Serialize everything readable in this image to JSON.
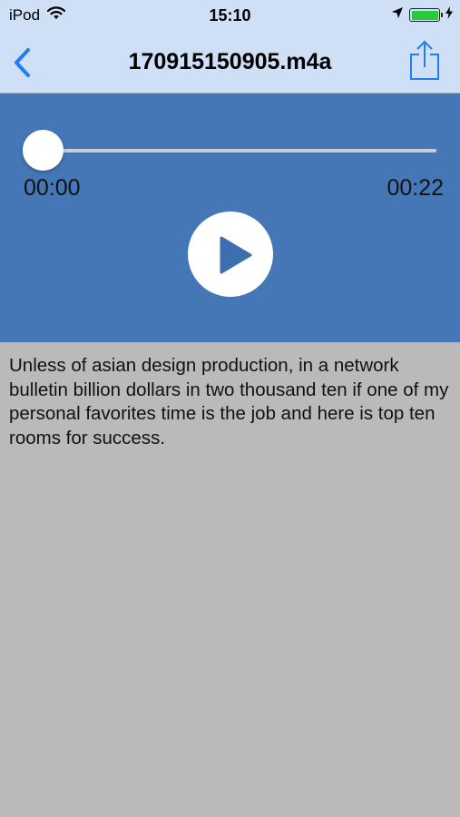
{
  "status_bar": {
    "carrier": "iPod",
    "time": "15:10",
    "battery_level": 1.0,
    "battery_color": "#27c93f"
  },
  "nav": {
    "title": "170915150905.m4a",
    "back_icon": "chevron-left",
    "share_icon": "share",
    "accent_color": "#1f7ef2"
  },
  "player": {
    "current_time": "00:00",
    "total_time": "00:22",
    "progress": 0,
    "play_icon": "play",
    "background_color": "#4577b7"
  },
  "transcript": {
    "text": "Unless of asian design production, in a network bulletin billion dollars in two thousand ten if one of my personal favorites time is the job and here is top ten rooms for success."
  }
}
